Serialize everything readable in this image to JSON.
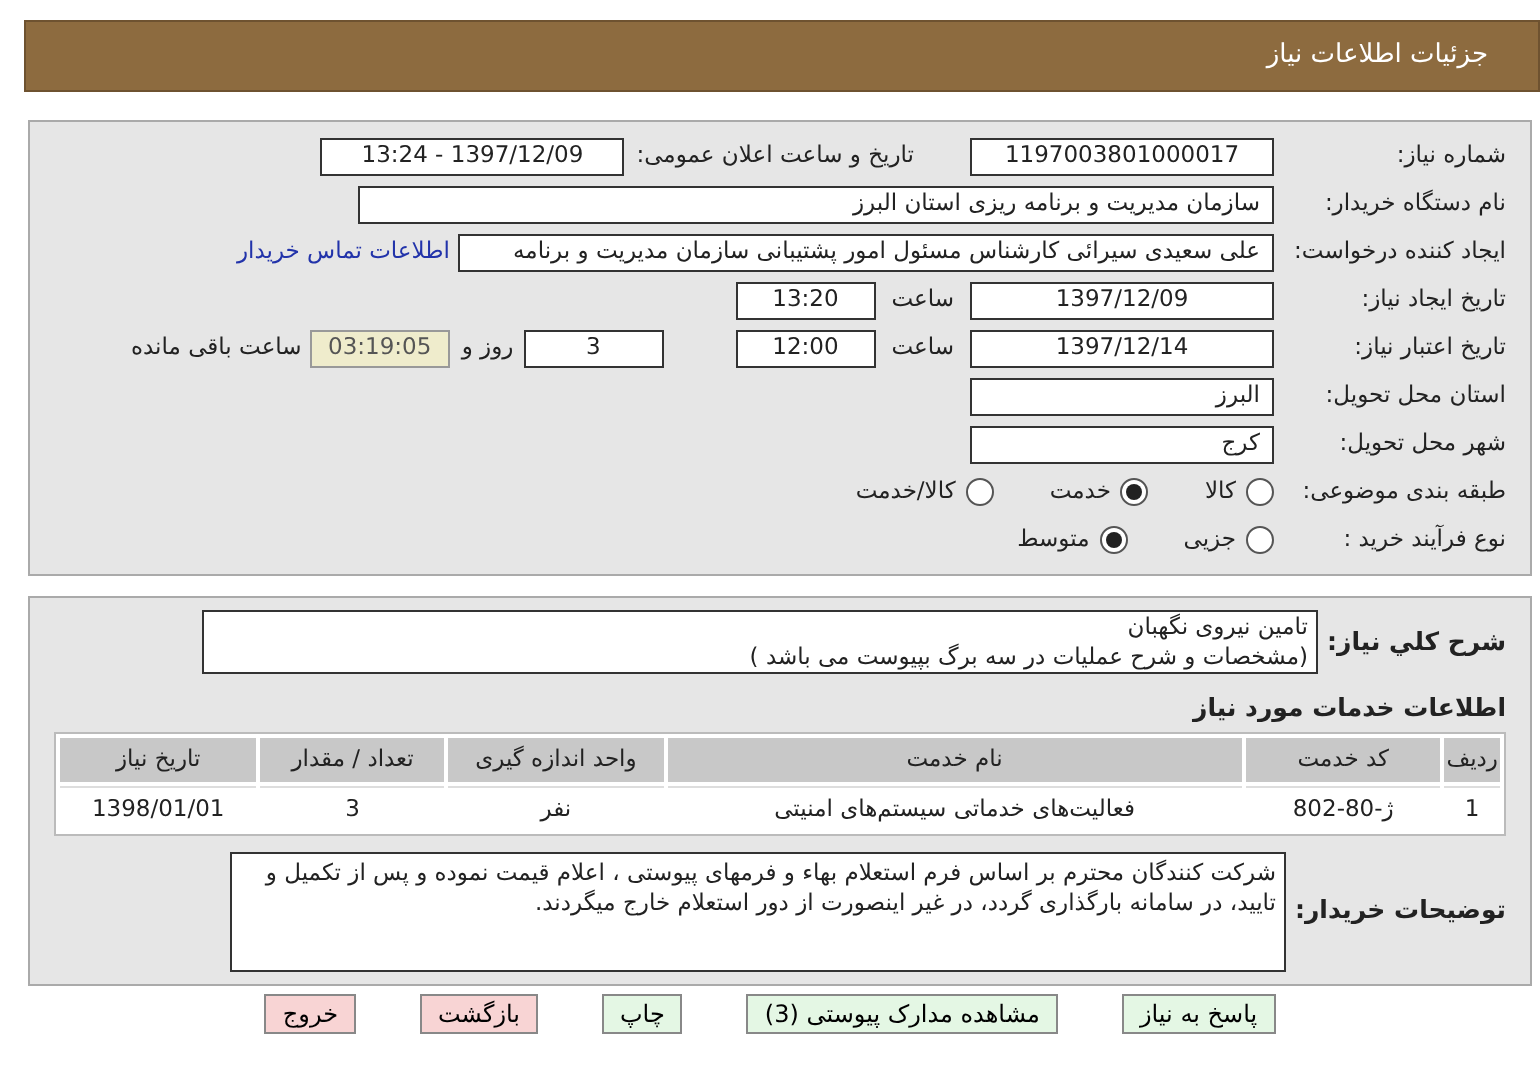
{
  "header": {
    "title": "جزئیات اطلاعات نیاز"
  },
  "need_number": {
    "label": "شماره نیاز:",
    "value": "1197003801000017"
  },
  "announce": {
    "label": "تاریخ و ساعت اعلان عمومی:",
    "value": "1397/12/09 - 13:24"
  },
  "buyer": {
    "label": "نام دستگاه خریدار:",
    "value": "سازمان مدیریت و برنامه ریزی استان البرز"
  },
  "requester": {
    "label": "ایجاد کننده درخواست:",
    "value": "علی سعیدی سیرائی کارشناس مسئول امور پشتیبانی سازمان مدیریت و برنامه",
    "link": "اطلاعات تماس خریدار"
  },
  "created": {
    "label": "تاریخ ایجاد نیاز:",
    "date": "1397/12/09",
    "time_label": "ساعت",
    "time": "13:20"
  },
  "validity": {
    "label": "تاریخ اعتبار نیاز:",
    "date": "1397/12/14",
    "time_label": "ساعت",
    "time": "12:00",
    "days": "3",
    "days_label": "روز و",
    "remaining": "03:19:05",
    "remaining_label": "ساعت باقی مانده"
  },
  "province": {
    "label": "استان محل تحویل:",
    "value": "البرز"
  },
  "city": {
    "label": "شهر محل تحویل:",
    "value": "کرج"
  },
  "category": {
    "label": "طبقه بندی موضوعی:",
    "options": [
      {
        "label": "کالا",
        "selected": false
      },
      {
        "label": "خدمت",
        "selected": true
      },
      {
        "label": "کالا/خدمت",
        "selected": false
      }
    ]
  },
  "process": {
    "label": "نوع فرآیند خرید :",
    "options": [
      {
        "label": "جزیی",
        "selected": false
      },
      {
        "label": "متوسط",
        "selected": true
      }
    ]
  },
  "summary": {
    "label": "شرح کلي نياز:",
    "text": "تامین نیروی نگهبان\n(مشخصات و شرح عملیات در سه برگ بپیوست می باشد )"
  },
  "services": {
    "title": "اطلاعات خدمات مورد نیاز",
    "columns": [
      "ردیف",
      "کد خدمت",
      "نام خدمت",
      "واحد اندازه گیری",
      "تعداد / مقدار",
      "تاریخ نیاز"
    ],
    "rows": [
      [
        "1",
        "ژ-80-802",
        "فعالیت‌های خدماتی سیستم‌های امنیتی",
        "نفر",
        "3",
        "1398/01/01"
      ]
    ]
  },
  "buyer_notes": {
    "label": "توضیحات خریدار:",
    "text": "شرکت کنندگان محترم بر اساس فرم استعلام بهاء و فرمهای پیوستی ، اعلام قیمت نموده و پس از تکمیل و تایید، در سامانه بارگذاری گردد، در غیر اینصورت از دور استعلام خارج میگردند."
  },
  "buttons": [
    {
      "label": "پاسخ به نیاز",
      "kind": "action"
    },
    {
      "label": "مشاهده مدارک پیوستی (3)",
      "kind": "action"
    },
    {
      "label": "چاپ",
      "kind": "action"
    },
    {
      "label": "بازگشت",
      "kind": "nav"
    },
    {
      "label": "خروج",
      "kind": "nav"
    }
  ]
}
